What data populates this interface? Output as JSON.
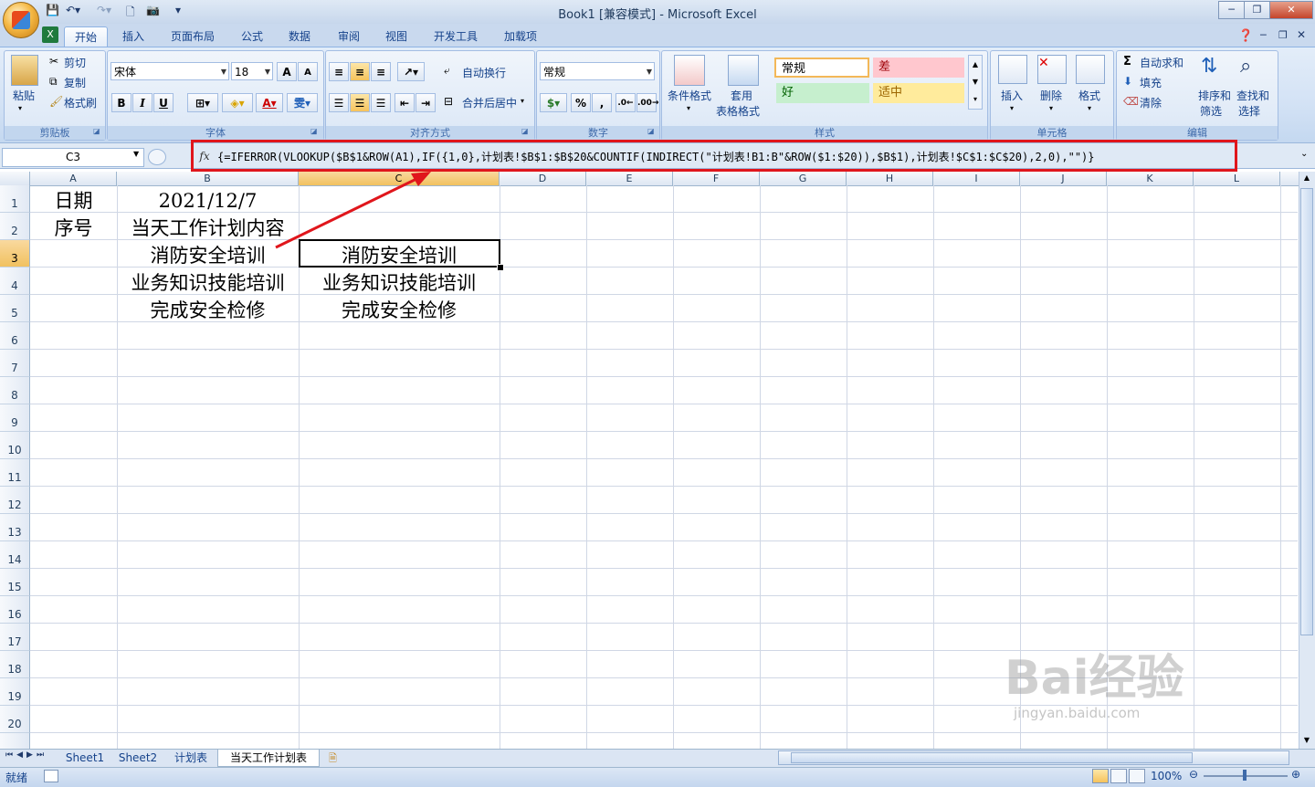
{
  "window": {
    "title": "Book1  [兼容模式] - Microsoft Excel",
    "minimize": "─",
    "restore": "❐",
    "close": "✕"
  },
  "ribbon": {
    "tabs": [
      "开始",
      "插入",
      "页面布局",
      "公式",
      "数据",
      "审阅",
      "视图",
      "开发工具",
      "加载项"
    ],
    "clipboard": {
      "paste": "粘贴",
      "cut": "剪切",
      "copy": "复制",
      "format_painter": "格式刷",
      "label": "剪贴板"
    },
    "font": {
      "name": "宋体",
      "size": "18",
      "bold": "B",
      "italic": "I",
      "underline": "U",
      "grow": "A",
      "shrink": "A",
      "label": "字体"
    },
    "alignment": {
      "wrap": "自动换行",
      "merge": "合并后居中",
      "label": "对齐方式"
    },
    "number": {
      "format": "常规",
      "percent": "%",
      "comma": ",",
      "label": "数字"
    },
    "styles": {
      "conditional": "条件格式",
      "table_1": "套用",
      "table_2": "表格格式",
      "normal": "常规",
      "bad": "差",
      "good": "好",
      "neutral": "适中",
      "label": "样式"
    },
    "cells": {
      "insert": "插入",
      "delete": "删除",
      "format": "格式",
      "label": "单元格"
    },
    "editing": {
      "autosum": "自动求和",
      "fill": "填充",
      "clear": "清除",
      "sort_1": "排序和",
      "sort_2": "筛选",
      "find_1": "查找和",
      "find_2": "选择",
      "label": "编辑"
    }
  },
  "formula_bar": {
    "name_box": "C3",
    "fx": "fx",
    "formula": "{=IFERROR(VLOOKUP($B$1&ROW(A1),IF({1,0},计划表!$B$1:$B$20&COUNTIF(INDIRECT(\"计划表!B1:B\"&ROW($1:$20)),$B$1),计划表!$C$1:$C$20),2,0),\"\")}"
  },
  "grid": {
    "columns": [
      "A",
      "B",
      "C",
      "D",
      "E",
      "F",
      "G",
      "H",
      "I",
      "J",
      "K",
      "L"
    ],
    "rows": [
      "1",
      "2",
      "3",
      "4",
      "5",
      "6",
      "7",
      "8",
      "9",
      "10",
      "11",
      "12",
      "13",
      "14",
      "15",
      "16",
      "17",
      "18",
      "19",
      "20"
    ],
    "cells": {
      "A1": "日期",
      "B1": "2021/12/7",
      "A2": "序号",
      "B2": "当天工作计划内容",
      "B3": "消防安全培训",
      "C3": "消防安全培训",
      "B4": "业务知识技能培训",
      "C4": "业务知识技能培训",
      "B5": "完成安全检修",
      "C5": "完成安全检修"
    }
  },
  "sheets": [
    "Sheet1",
    "Sheet2",
    "计划表",
    "当天工作计划表"
  ],
  "active_sheet": "当天工作计划表",
  "status": {
    "ready": "就绪",
    "zoom": "100%"
  },
  "watermark": {
    "logo": "Bai经验",
    "url": "jingyan.baidu.com"
  },
  "colors": {
    "accent": "#15428b",
    "selection_header": "#f1c15f",
    "annotation": "#e0161c"
  }
}
